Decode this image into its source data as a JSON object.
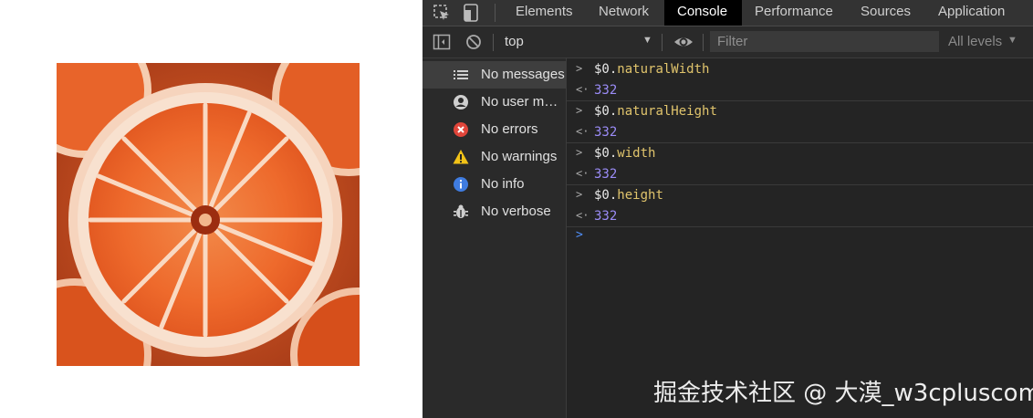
{
  "preview": {
    "image_alt": "orange slice photo",
    "icon": "image-icon"
  },
  "devtools": {
    "tabs": [
      {
        "label": "Elements",
        "active": false
      },
      {
        "label": "Network",
        "active": false
      },
      {
        "label": "Console",
        "active": true
      },
      {
        "label": "Performance",
        "active": false
      },
      {
        "label": "Sources",
        "active": false
      },
      {
        "label": "Application",
        "active": false
      }
    ],
    "toolbar": {
      "context": "top",
      "filter_placeholder": "Filter",
      "filter_value": "",
      "levels": "All levels"
    },
    "sidebar": [
      {
        "label": "No messages",
        "icon": "list-icon",
        "selected": true
      },
      {
        "label": "No user me…",
        "icon": "user-icon",
        "selected": false
      },
      {
        "label": "No errors",
        "icon": "error-icon",
        "selected": false
      },
      {
        "label": "No warnings",
        "icon": "warning-icon",
        "selected": false
      },
      {
        "label": "No info",
        "icon": "info-icon",
        "selected": false
      },
      {
        "label": "No verbose",
        "icon": "bug-icon",
        "selected": false
      }
    ],
    "console": [
      {
        "object": "$0.",
        "property": "naturalWidth",
        "result": "332"
      },
      {
        "object": "$0.",
        "property": "naturalHeight",
        "result": "332"
      },
      {
        "object": "$0.",
        "property": "width",
        "result": "332"
      },
      {
        "object": "$0.",
        "property": "height",
        "result": "332"
      }
    ],
    "input_prompt": ">"
  },
  "watermark": "掘金技术社区 @ 大漠_w3cpluscom",
  "colors": {
    "panel_bg": "#242424",
    "active_tab": "#000000",
    "property": "#e0c46c",
    "number": "#9b8cf7",
    "prompt": "#4f8ef7",
    "error": "#e0453a",
    "warning": "#f2c318",
    "info": "#3f7ce0"
  }
}
